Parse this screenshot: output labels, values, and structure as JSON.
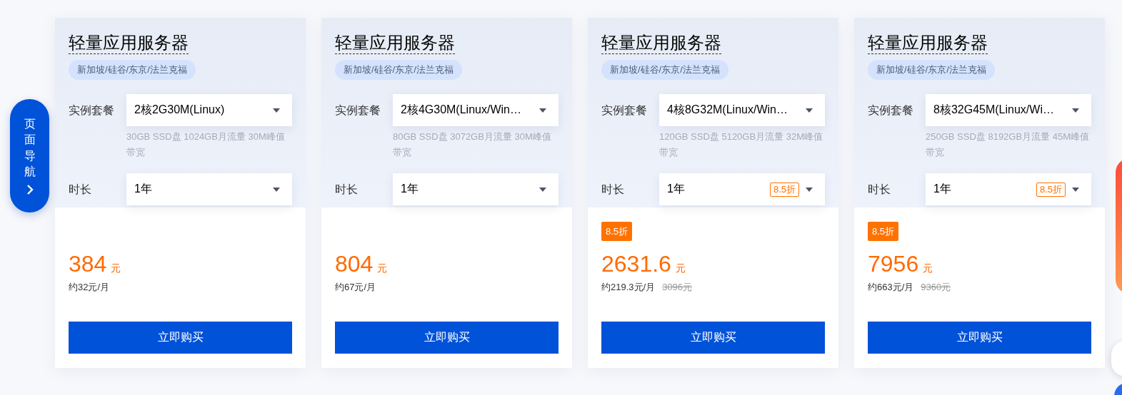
{
  "side_nav": {
    "label": "页面导航"
  },
  "cards": [
    {
      "title": "轻量应用服务器",
      "regions": "新加坡/硅谷/东京/法兰克福",
      "plan_label": "实例套餐",
      "plan_value": "2核2G30M(Linux)",
      "plan_desc": "30GB SSD盘 1024GB月流量 30M峰值带宽",
      "duration_label": "时长",
      "duration_value": "1年",
      "price": "384",
      "unit": "元",
      "monthly": "约32元/月",
      "button": "立即购买"
    },
    {
      "title": "轻量应用服务器",
      "regions": "新加坡/硅谷/东京/法兰克福",
      "plan_label": "实例套餐",
      "plan_value": "2核4G30M(Linux/Win…",
      "plan_desc": "80GB SSD盘 3072GB月流量 30M峰值带宽",
      "duration_label": "时长",
      "duration_value": "1年",
      "price": "804",
      "unit": "元",
      "monthly": "约67元/月",
      "button": "立即购买"
    },
    {
      "title": "轻量应用服务器",
      "regions": "新加坡/硅谷/东京/法兰克福",
      "plan_label": "实例套餐",
      "plan_value": "4核8G32M(Linux/Win…",
      "plan_desc": "120GB SSD盘 5120GB月流量 32M峰值带宽",
      "duration_label": "时长",
      "duration_value": "1年",
      "duration_discount": "8.5折",
      "discount_badge": "8.5折",
      "price": "2631.6",
      "unit": "元",
      "monthly": "约219.3元/月",
      "original_price": "3096元",
      "button": "立即购买"
    },
    {
      "title": "轻量应用服务器",
      "regions": "新加坡/硅谷/东京/法兰克福",
      "plan_label": "实例套餐",
      "plan_value": "8核32G45M(Linux/Wi…",
      "plan_desc": "250GB SSD盘 8192GB月流量 45M峰值带宽",
      "duration_label": "时长",
      "duration_value": "1年",
      "duration_discount": "8.5折",
      "discount_badge": "8.5折",
      "price": "7956",
      "unit": "元",
      "monthly": "约663元/月",
      "original_price": "9360元",
      "button": "立即购买"
    }
  ]
}
